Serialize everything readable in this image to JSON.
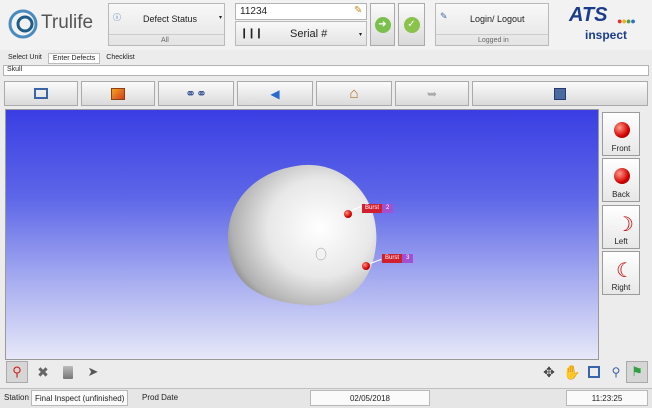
{
  "header": {
    "logo_text": "Trulife",
    "defect_status_label": "Defect Status",
    "defect_status_sub": "All",
    "serial_value": "11234",
    "serial_label": "Serial #",
    "login_label": "Login/ Logout",
    "login_sub": "Logged in",
    "brand_top": "ATS",
    "brand_bottom": "inspect"
  },
  "tabs": [
    {
      "label": "Select Unit"
    },
    {
      "label": "Enter Defects"
    },
    {
      "label": "Checklist"
    }
  ],
  "search": {
    "value": "Skull"
  },
  "viewer": {
    "markers": [
      {
        "label": "Burst",
        "number": "2"
      },
      {
        "label": "Burst",
        "number": "3"
      }
    ]
  },
  "views": [
    {
      "label": "Front"
    },
    {
      "label": "Back"
    },
    {
      "label": "Left"
    },
    {
      "label": "Right"
    }
  ],
  "status_bar": {
    "station_label": "Station",
    "station_value": "Final Inspect (unfinished)",
    "prod_date_label": "Prod Date",
    "prod_date_value": "02/05/2018",
    "time": "11:23:25"
  },
  "colors": {
    "accent_green": "#6ab04c",
    "marker_red": "#d40000",
    "viewer_top": "#3a3ee3"
  }
}
